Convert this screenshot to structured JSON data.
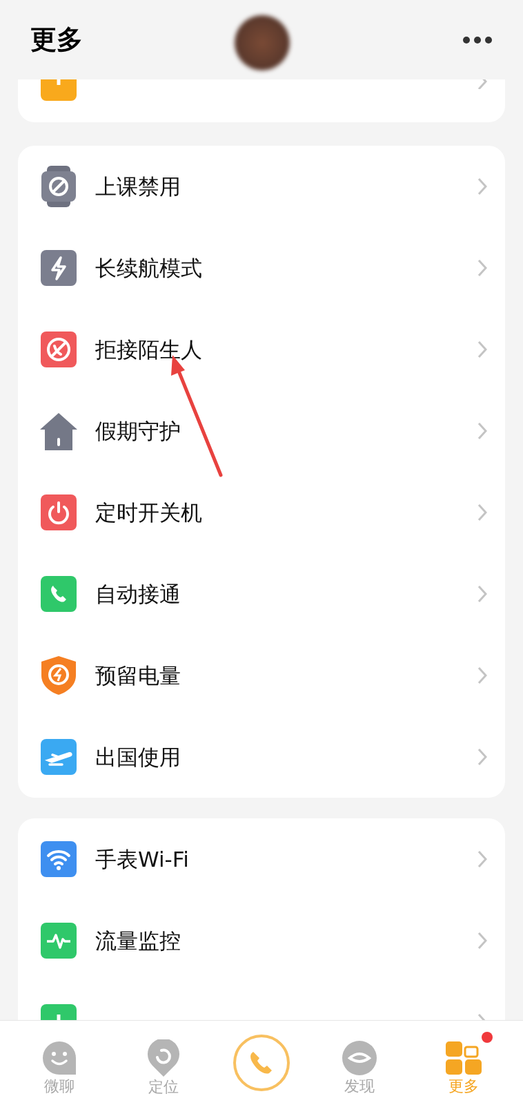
{
  "header": {
    "title": "更多"
  },
  "sections": [
    {
      "items": [
        {
          "label": "上课禁用"
        },
        {
          "label": "长续航模式"
        },
        {
          "label": "拒接陌生人"
        },
        {
          "label": "假期守护"
        },
        {
          "label": "定时开关机"
        },
        {
          "label": "自动接通"
        },
        {
          "label": "预留电量"
        },
        {
          "label": "出国使用"
        }
      ]
    },
    {
      "items": [
        {
          "label": "手表Wi-Fi"
        },
        {
          "label": "流量监控"
        }
      ]
    }
  ],
  "tabs": [
    {
      "label": "微聊",
      "selected": false,
      "badge": false
    },
    {
      "label": "定位",
      "selected": false,
      "badge": false
    },
    {
      "label": "发现",
      "selected": false,
      "badge": false
    },
    {
      "label": "更多",
      "selected": true,
      "badge": true
    }
  ]
}
